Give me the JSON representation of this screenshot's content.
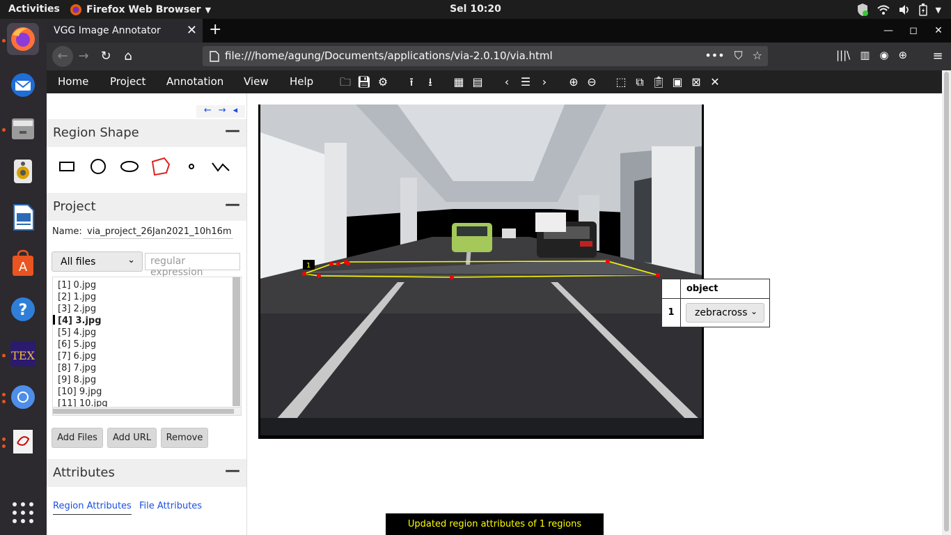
{
  "system": {
    "activities": "Activities",
    "app_name": "Firefox Web Browser",
    "clock": "Sel 10:20"
  },
  "browser": {
    "tab_title": "VGG Image Annotator",
    "url": "file:///home/agung/Documents/applications/via-2.0.10/via.html"
  },
  "via": {
    "menu": [
      "Home",
      "Project",
      "Annotation",
      "View",
      "Help"
    ],
    "nav_arrows": [
      "←",
      "→",
      "◂"
    ],
    "sections": {
      "region_shape": "Region Shape",
      "project": "Project",
      "attributes": "Attributes"
    },
    "project": {
      "name_label": "Name:",
      "name_value": "via_project_26Jan2021_10h16m",
      "filter_value": "All files",
      "regex_placeholder": "regular expression"
    },
    "files": [
      "[1] 0.jpg",
      "[2] 1.jpg",
      "[3] 2.jpg",
      "[4] 3.jpg",
      "[5] 4.jpg",
      "[6] 5.jpg",
      "[7] 6.jpg",
      "[8] 7.jpg",
      "[9] 8.jpg",
      "[10] 9.jpg",
      "[11] 10.jpg"
    ],
    "selected_file_index": 3,
    "buttons": {
      "add_files": "Add Files",
      "add_url": "Add URL",
      "remove": "Remove"
    },
    "attribute_tabs": {
      "region": "Region Attributes",
      "file": "File Attributes"
    },
    "region_label": "1",
    "attr_table": {
      "header": "object",
      "row_id": "1",
      "value": "zebracross"
    },
    "status": "Updated region attributes of 1 regions"
  },
  "colors": {
    "region_outline": "#ffff00",
    "vertex": "#ff0000",
    "status_text": "#ffff00",
    "active_shape": "#e02020"
  }
}
